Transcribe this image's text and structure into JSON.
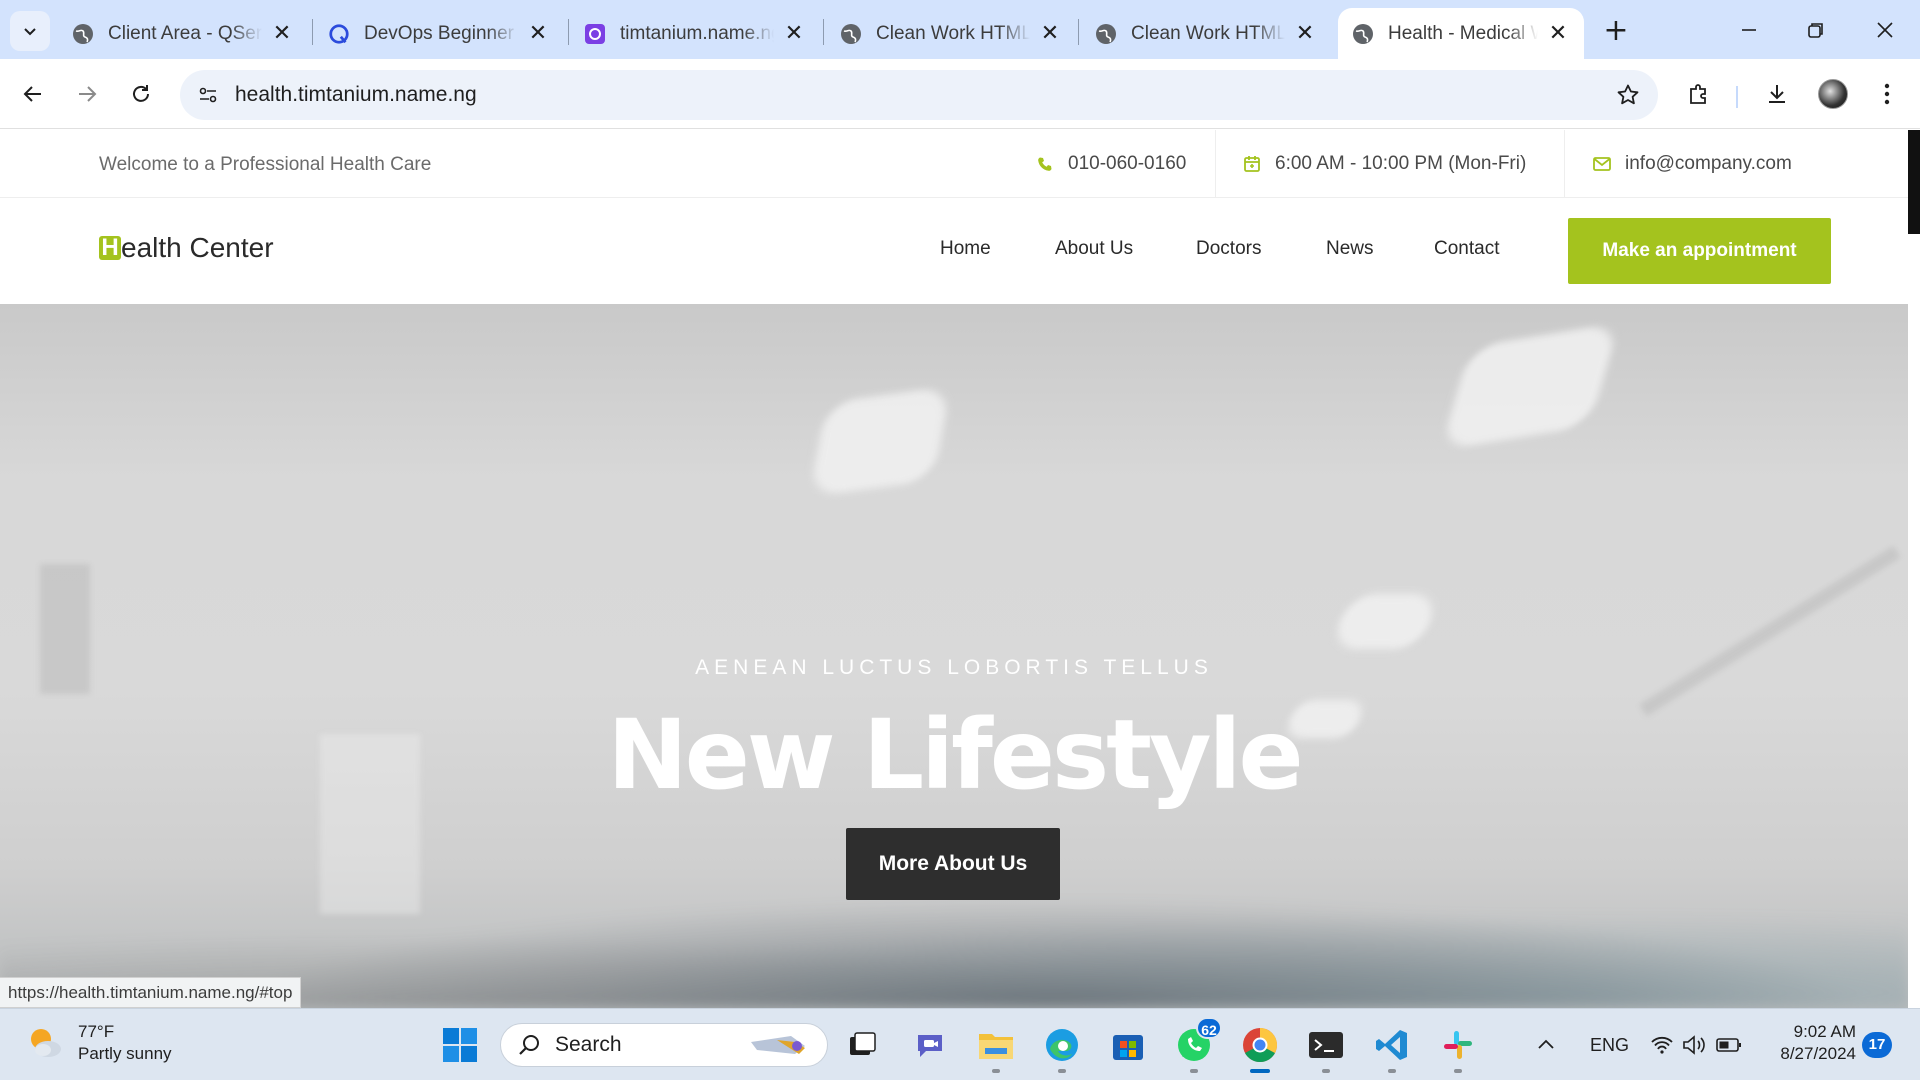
{
  "browser": {
    "tabs": [
      {
        "title": "Client Area - QServers",
        "icon": "globe-icon"
      },
      {
        "title": "DevOps Beginner Course",
        "icon": "devops-q-icon"
      },
      {
        "title": "timtanium.name.ng",
        "icon": "purple-app-icon"
      },
      {
        "title": "Clean Work HTML Template",
        "icon": "globe-icon"
      },
      {
        "title": "Clean Work HTML Template",
        "icon": "globe-icon"
      },
      {
        "title": "Health - Medical Website",
        "icon": "globe-icon",
        "active": true
      }
    ],
    "url": "health.timtanium.name.ng",
    "status_url": "https://health.timtanium.name.ng/#top"
  },
  "site": {
    "topbar": {
      "welcome": "Welcome to a Professional Health Care",
      "phone": "010-060-0160",
      "hours": "6:00 AM - 10:00 PM (Mon-Fri)",
      "email": "info@company.com"
    },
    "logo": {
      "first_letter": "H",
      "rest": "ealth Center"
    },
    "nav": [
      "Home",
      "About Us",
      "Doctors",
      "News",
      "Contact"
    ],
    "cta": "Make an appointment",
    "hero": {
      "subtitle": "AENEAN LUCTUS LOBORTIS TELLUS",
      "title": "New Lifestyle",
      "button": "More About Us"
    },
    "accent_color": "#a4c31e"
  },
  "taskbar": {
    "weather": {
      "temp": "77°F",
      "desc": "Partly sunny"
    },
    "search_label": "Search",
    "whatsapp_badge": "62",
    "language": "ENG",
    "time": "9:02 AM",
    "date": "8/27/2024",
    "notifications": "17"
  }
}
